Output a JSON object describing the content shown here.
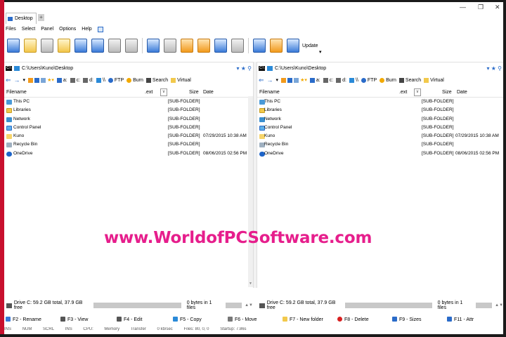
{
  "window": {
    "tab_label": "Desktop",
    "minimize": "—",
    "restore": "❐",
    "close": "✕"
  },
  "menu": [
    "Files",
    "Select",
    "Panel",
    "Options",
    "Help"
  ],
  "toolbar": {
    "update_label": "Update"
  },
  "left_panel": {
    "path": "C:\\Users\\Kuno\\Desktop",
    "drive_label": "C:",
    "nav": {
      "a": "a:",
      "c": "c:",
      "d": "d:",
      "unc": "\\\\",
      "ftp": "FTP",
      "burn": "Burn",
      "search": "Search",
      "virtual": "Virtual"
    },
    "columns": {
      "filename": "Filename",
      "ext": ".ext",
      "size": "Size",
      "date": "Date"
    },
    "rows": [
      {
        "name": "This PC",
        "size": "[SUB-FOLDER]",
        "date": "",
        "icon": "pc"
      },
      {
        "name": "Libraries",
        "size": "[SUB-FOLDER]",
        "date": "",
        "icon": "lib"
      },
      {
        "name": "Network",
        "size": "[SUB-FOLDER]",
        "date": "",
        "icon": "net"
      },
      {
        "name": "Control Panel",
        "size": "[SUB-FOLDER]",
        "date": "",
        "icon": "cp"
      },
      {
        "name": "Kuno",
        "size": "[SUB-FOLDER]",
        "date": "07/29/2015 10:38 AM",
        "icon": "usr"
      },
      {
        "name": "Recycle Bin",
        "size": "[SUB-FOLDER]",
        "date": "",
        "icon": "bin"
      },
      {
        "name": "OneDrive",
        "size": "[SUB-FOLDER]",
        "date": "08/06/2015 02:56 PM",
        "icon": "od"
      }
    ],
    "status": {
      "drive": "Drive C: 59.2 GB total, 37.9 GB free",
      "selection": "0 bytes in 1 files"
    }
  },
  "right_panel": {
    "path": "C:\\Users\\Kuno\\Desktop",
    "drive_label": "C:",
    "nav": {
      "a": "a:",
      "c": "c:",
      "d": "d:",
      "unc": "\\\\",
      "ftp": "FTP",
      "burn": "Burn",
      "search": "Search",
      "virtual": "Virtual"
    },
    "columns": {
      "filename": "Filename",
      "ext": ".ext",
      "size": "Size",
      "date": "Date"
    },
    "rows": [
      {
        "name": "This PC",
        "size": "[SUB-FOLDER]",
        "date": "",
        "icon": "pc"
      },
      {
        "name": "Libraries",
        "size": "[SUB-FOLDER]",
        "date": "",
        "icon": "lib"
      },
      {
        "name": "Network",
        "size": "[SUB-FOLDER]",
        "date": "",
        "icon": "net"
      },
      {
        "name": "Control Panel",
        "size": "[SUB-FOLDER]",
        "date": "",
        "icon": "cp"
      },
      {
        "name": "Kuno",
        "size": "[SUB-FOLDER]",
        "date": "07/29/2015 10:38 AM",
        "icon": "usr"
      },
      {
        "name": "Recycle Bin",
        "size": "[SUB-FOLDER]",
        "date": "",
        "icon": "bin"
      },
      {
        "name": "OneDrive",
        "size": "[SUB-FOLDER]",
        "date": "08/06/2015 02:56 PM",
        "icon": "od"
      }
    ],
    "status": {
      "drive": "Drive C: 59.2 GB total, 37.9 GB free",
      "selection": "0 bytes in 1 files"
    }
  },
  "watermark": "www.WorldofPCSoftware.com",
  "function_keys": [
    {
      "label": "F2 - Rename",
      "color": "#3a7ad8"
    },
    {
      "label": "F3 - View",
      "color": "#555555"
    },
    {
      "label": "F4 - Edit",
      "color": "#555555"
    },
    {
      "label": "F5 - Copy",
      "color": "#2a8ad8"
    },
    {
      "label": "F6 - Move",
      "color": "#777777"
    },
    {
      "label": "F7 - New folder",
      "color": "#f2c94c"
    },
    {
      "label": "F8 - Delete",
      "color": "#d82020"
    },
    {
      "label": "F9 - Sizes",
      "color": "#2a6bc9"
    },
    {
      "label": "F11 - Attr",
      "color": "#2a6bc9"
    }
  ],
  "bottom_strip": [
    "INS",
    "NUM",
    "SCRL",
    "INS",
    "CPU:",
    "Memory",
    "Transfer",
    "0 kb/sec",
    "Files: 80, 0, 0",
    "Startup: 7.86s"
  ]
}
